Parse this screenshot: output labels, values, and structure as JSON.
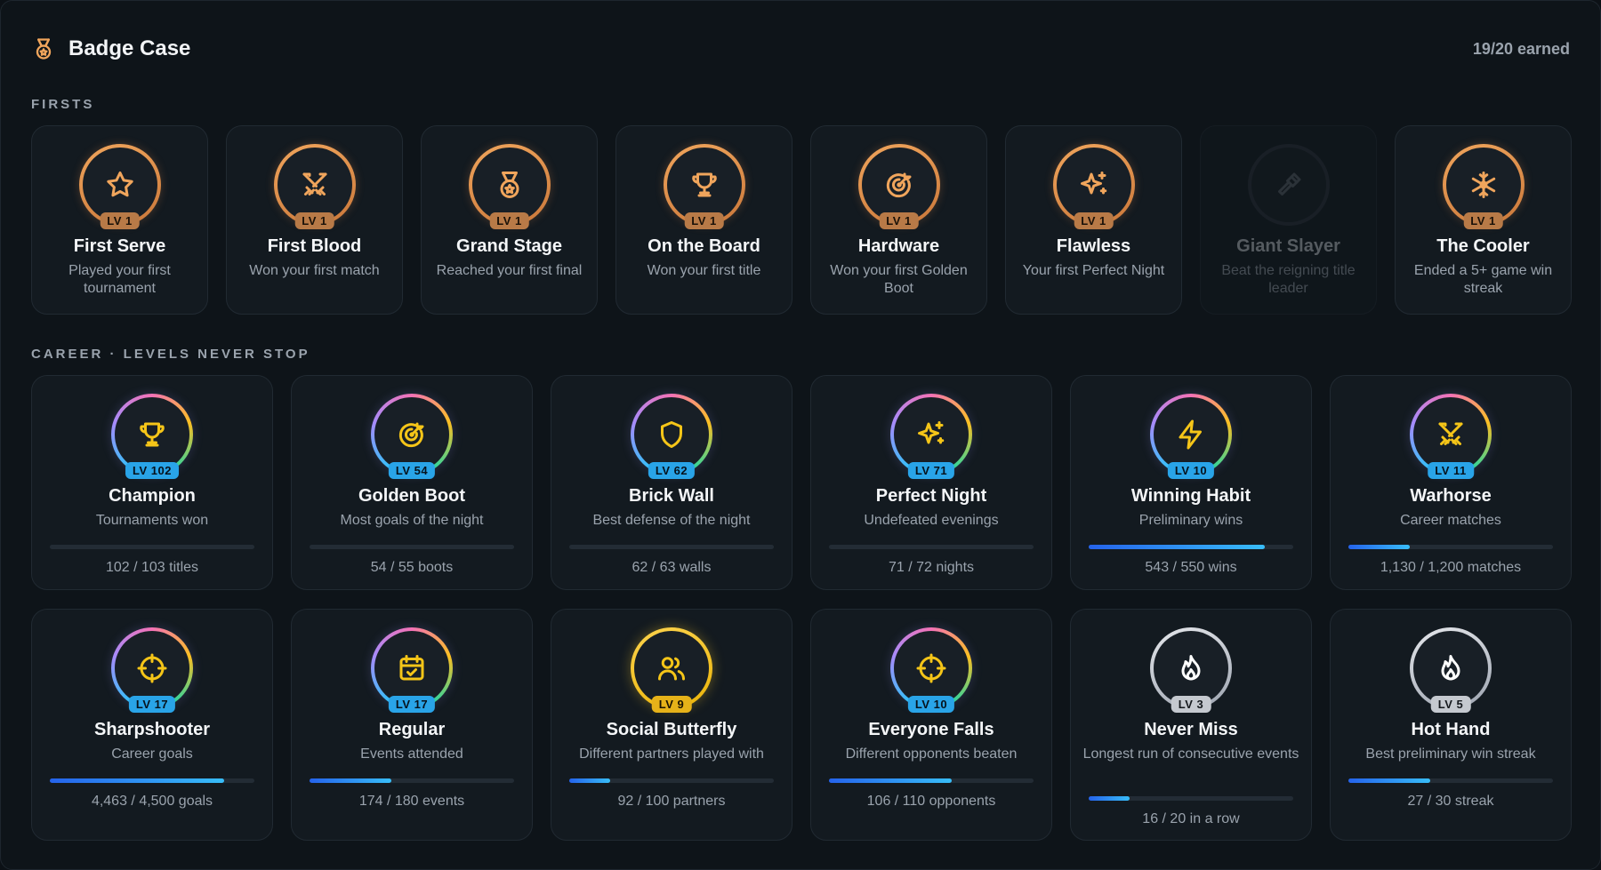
{
  "header": {
    "title": "Badge Case",
    "earned": "19/20 earned",
    "icon": "medal-icon"
  },
  "sections": {
    "firsts": "FIRSTS",
    "career": "CAREER · LEVELS NEVER STOP"
  },
  "colors": {
    "bronze": "#d98b4a",
    "gold": "#f5c518",
    "blue_level": "#29a4e8",
    "silver": "#c5c9cf",
    "progress": "#2f8ff0"
  },
  "firsts": [
    {
      "name": "First Serve",
      "desc": "Played your first tournament",
      "level": "LV 1",
      "icon": "star-icon",
      "locked": false
    },
    {
      "name": "First Blood",
      "desc": "Won your first match",
      "level": "LV 1",
      "icon": "crossed-swords-icon",
      "locked": false
    },
    {
      "name": "Grand Stage",
      "desc": "Reached your first final",
      "level": "LV 1",
      "icon": "medal-icon",
      "locked": false
    },
    {
      "name": "On the Board",
      "desc": "Won your first title",
      "level": "LV 1",
      "icon": "trophy-icon",
      "locked": false
    },
    {
      "name": "Hardware",
      "desc": "Won your first Golden Boot",
      "level": "LV 1",
      "icon": "target-arrow-icon",
      "locked": false
    },
    {
      "name": "Flawless",
      "desc": "Your first Perfect Night",
      "level": "LV 1",
      "icon": "sparkles-icon",
      "locked": false
    },
    {
      "name": "Giant Slayer",
      "desc": "Beat the reigning title leader",
      "level": "",
      "icon": "hammer-icon",
      "locked": true
    },
    {
      "name": "The Cooler",
      "desc": "Ended a 5+ game win streak",
      "level": "LV 1",
      "icon": "snowflake-icon",
      "locked": false
    }
  ],
  "career": [
    {
      "name": "Champion",
      "desc": "Tournaments won",
      "level": "LV 102",
      "progress_text": "102 / 103 titles",
      "progress": 0,
      "tier": "rainbow",
      "icon": "trophy-icon"
    },
    {
      "name": "Golden Boot",
      "desc": "Most goals of the night",
      "level": "LV 54",
      "progress_text": "54 / 55 boots",
      "progress": 0,
      "tier": "rainbow",
      "icon": "target-arrow-icon"
    },
    {
      "name": "Brick Wall",
      "desc": "Best defense of the night",
      "level": "LV 62",
      "progress_text": "62 / 63 walls",
      "progress": 0,
      "tier": "rainbow",
      "icon": "shield-icon"
    },
    {
      "name": "Perfect Night",
      "desc": "Undefeated evenings",
      "level": "LV 71",
      "progress_text": "71 / 72 nights",
      "progress": 0,
      "tier": "rainbow",
      "icon": "sparkles-icon"
    },
    {
      "name": "Winning Habit",
      "desc": "Preliminary wins",
      "level": "LV 10",
      "progress_text": "543 / 550 wins",
      "progress": 0.86,
      "tier": "rainbow",
      "icon": "lightning-icon"
    },
    {
      "name": "Warhorse",
      "desc": "Career matches",
      "level": "LV 11",
      "progress_text": "1,130 / 1,200 matches",
      "progress": 0.3,
      "tier": "rainbow",
      "icon": "crossed-swords-icon"
    },
    {
      "name": "Sharpshooter",
      "desc": "Career goals",
      "level": "LV 17",
      "progress_text": "4,463 / 4,500 goals",
      "progress": 0.85,
      "tier": "rainbow",
      "icon": "crosshair-icon"
    },
    {
      "name": "Regular",
      "desc": "Events attended",
      "level": "LV 17",
      "progress_text": "174 / 180 events",
      "progress": 0.4,
      "tier": "rainbow",
      "icon": "calendar-check-icon"
    },
    {
      "name": "Social Butterfly",
      "desc": "Different partners played with",
      "level": "LV 9",
      "progress_text": "92 / 100 partners",
      "progress": 0.2,
      "tier": "gold",
      "icon": "users-icon"
    },
    {
      "name": "Everyone Falls",
      "desc": "Different opponents beaten",
      "level": "LV 10",
      "progress_text": "106 / 110 opponents",
      "progress": 0.6,
      "tier": "rainbow",
      "icon": "crosshair-icon"
    },
    {
      "name": "Never Miss",
      "desc": "Longest run of consecutive events",
      "level": "LV 3",
      "progress_text": "16 / 20 in a row",
      "progress": 0.2,
      "tier": "silver",
      "icon": "flame-icon"
    },
    {
      "name": "Hot Hand",
      "desc": "Best preliminary win streak",
      "level": "LV 5",
      "progress_text": "27 / 30 streak",
      "progress": 0.4,
      "tier": "silver",
      "icon": "flame-icon"
    }
  ]
}
